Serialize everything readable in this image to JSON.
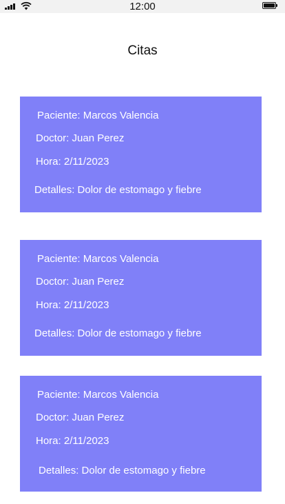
{
  "status_bar": {
    "time": "12:00",
    "signal_icon": "cellular-signal-icon",
    "wifi_icon": "wifi-icon",
    "battery_icon": "battery-icon",
    "battery_level": 1.0
  },
  "page": {
    "title": "Citas"
  },
  "appointments": [
    {
      "patient": "Paciente: Marcos Valencia",
      "doctor": "Doctor: Juan Perez",
      "time": "Hora: 2/11/2023",
      "details": "Detalles: Dolor de estomago y fiebre"
    },
    {
      "patient": "Paciente: Marcos Valencia",
      "doctor": "Doctor: Juan Perez",
      "time": "Hora: 2/11/2023",
      "details": "Detalles: Dolor de estomago y fiebre"
    },
    {
      "patient": "Paciente: Marcos Valencia",
      "doctor": "Doctor: Juan Perez",
      "time": "Hora: 2/11/2023",
      "details": "Detalles: Dolor de estomago y fiebre"
    }
  ],
  "colors": {
    "card_background": "#8080f8",
    "card_text": "#ffffff",
    "status_bar_background": "#f2f2f2"
  }
}
